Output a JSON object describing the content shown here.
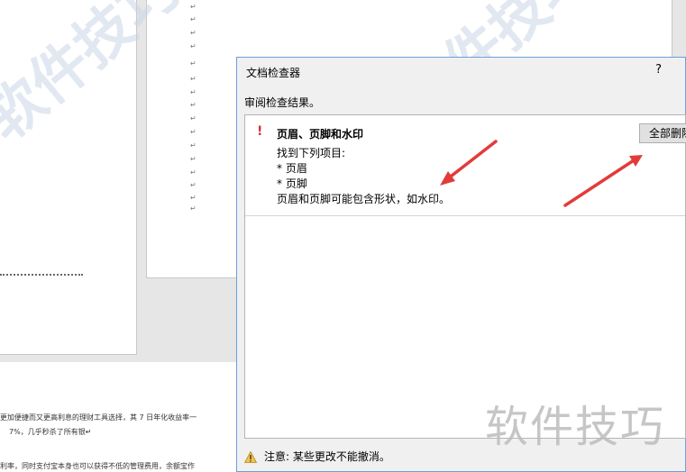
{
  "document": {
    "pilcrow_mark": "↵",
    "bottom_text_lines": [
      "更加便捷而又更高利息的理财工具选择，其 7 日年化收益率一",
      "7%，几乎秒杀了所有银↵",
      "利率，同时支付宝本身也可以获得不低的管理费用，余额宝作"
    ]
  },
  "watermarks": {
    "diagonal_text": "软件技巧",
    "corner_text": "软件技巧"
  },
  "dialog": {
    "title": "文档检查器",
    "help_label": "?",
    "subtitle": "审阅检查结果。",
    "result": {
      "alert_mark": "!",
      "title": "页眉、页脚和水印",
      "lines": [
        "找到下列项目:",
        "* 页眉",
        "* 页脚",
        "页眉和页脚可能包含形状，如水印。"
      ],
      "button_label": "全部删除"
    },
    "footer_note": "注意: 某些更改不能撤消。"
  },
  "colors": {
    "accent_border": "#6aa0d8",
    "alert_red": "#d13438",
    "annotation_arrow": "#e23b3b",
    "warning_triangle": "#f2c34d"
  },
  "icons": {
    "alert": "exclamation-icon",
    "warning": "warning-triangle-icon"
  }
}
